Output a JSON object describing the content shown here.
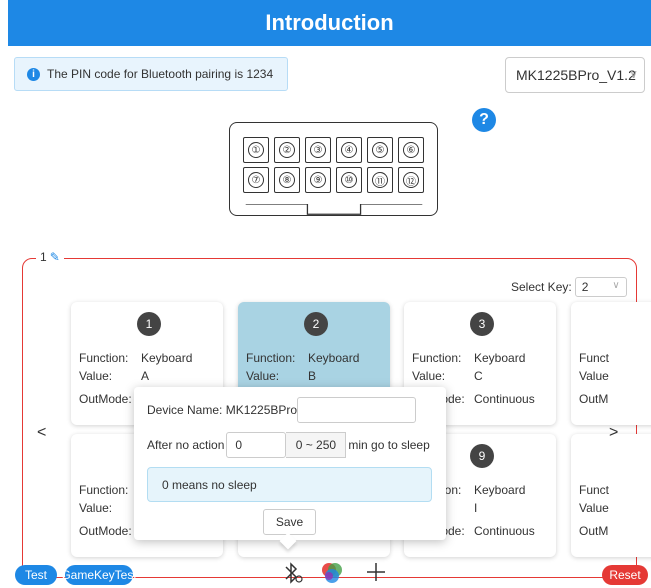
{
  "header": {
    "title": "Introduction"
  },
  "info": {
    "icon": "info-icon",
    "text": "The PIN code for Bluetooth pairing is 1234"
  },
  "version": {
    "selected": "MK1225BPro_V1.2"
  },
  "help": {
    "icon": "help-icon",
    "glyph": "?"
  },
  "device_keys": [
    "①",
    "②",
    "③",
    "④",
    "⑤",
    "⑥",
    "⑦",
    "⑧",
    "⑨",
    "⑩",
    "⑪",
    "⑫"
  ],
  "group": {
    "label": "1",
    "edit_icon": "pencil-icon"
  },
  "select_key": {
    "label": "Select Key:",
    "value": "2"
  },
  "cards": [
    {
      "num": "1",
      "function_label": "Function:",
      "function": "Keyboard",
      "value_label": "Value:",
      "value": "A",
      "outmode_label": "OutMode:",
      "outmode": ""
    },
    {
      "num": "2",
      "function_label": "Function:",
      "function": "Keyboard",
      "value_label": "Value:",
      "value": "B",
      "outmode_label": "",
      "outmode": ""
    },
    {
      "num": "3",
      "function_label": "Function:",
      "function": "Keyboard",
      "value_label": "Value:",
      "value": "C",
      "outmode_label": "OutMode:",
      "outmode": "Continuous"
    },
    {
      "num": "",
      "function_label": "Funct",
      "function": "",
      "value_label": "Value",
      "value": "",
      "outmode_label": "OutM",
      "outmode": ""
    },
    {
      "num": "",
      "function_label": "Function:",
      "function": "",
      "value_label": "Value:",
      "value": "",
      "outmode_label": "OutMode:",
      "outmode": ""
    },
    {
      "num": "9",
      "function_label": "Function:",
      "function": "Keyboard",
      "value_label": "",
      "value": "I",
      "outmode_label": "OutMode:",
      "outmode": "Continuous"
    },
    {
      "num": "",
      "function_label": "Funct",
      "function": "",
      "value_label": "Value",
      "value": "",
      "outmode_label": "OutM",
      "outmode": ""
    }
  ],
  "nav": {
    "prev": "<",
    "next": ">"
  },
  "popup": {
    "device_name_label": "Device Name: MK1225BPro",
    "device_name_value": "",
    "sleep_prefix": "After no action",
    "sleep_value": "0",
    "sleep_range": "0 ~ 250",
    "sleep_suffix": "min go to sleep",
    "note": "0 means no sleep",
    "save": "Save"
  },
  "footer": {
    "test": "Test",
    "gamekeytest": "GameKeyTest",
    "reset": "Reset",
    "icons": [
      "bluetooth-settings-icon",
      "color-wheel-icon",
      "plus-icon"
    ]
  },
  "colors": {
    "primary": "#1e88e5",
    "danger": "#e53935",
    "selected_card": "#a9d3e3"
  }
}
